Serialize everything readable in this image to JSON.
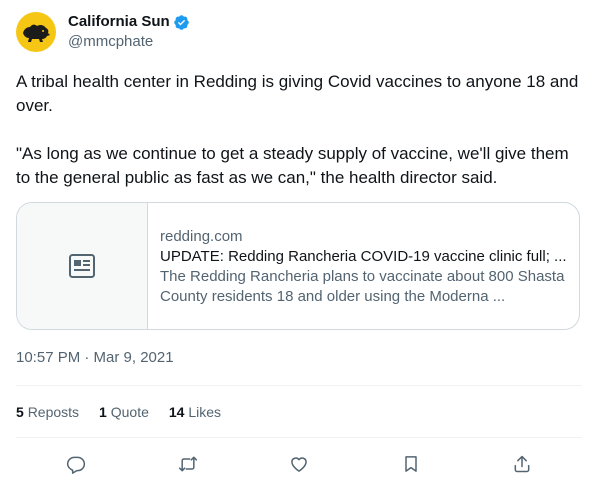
{
  "author": {
    "display_name": "California Sun",
    "handle": "@mmcphate",
    "verified": true,
    "avatar_bg": "#f6c614"
  },
  "tweet": {
    "paragraphs": [
      "A tribal health center in Redding is giving Covid vaccines to anyone 18 and over.",
      "\"As long as we continue to get a steady supply of vaccine, we'll give them to the general public as fast as we can,\" the health director said."
    ]
  },
  "card": {
    "domain": "redding.com",
    "title": "UPDATE: Redding Rancheria COVID-19 vaccine clinic full; ...",
    "description": "The Redding Rancheria plans to vaccinate about 800 Shasta County residents 18 and older using the Moderna ...",
    "thumb_icon": "article-icon"
  },
  "timestamp": "10:57 PM · Mar 9, 2021",
  "stats": {
    "reposts_count": "5",
    "reposts_label": "Reposts",
    "quotes_count": "1",
    "quotes_label": "Quote",
    "likes_count": "14",
    "likes_label": "Likes"
  },
  "actions": {
    "icons": [
      "reply-icon",
      "repost-icon",
      "like-icon",
      "bookmark-icon",
      "share-icon"
    ],
    "color": "#536471"
  },
  "colors": {
    "verified": "#1d9bf0",
    "secondary_text": "#536471",
    "border": "#cfd9de"
  }
}
